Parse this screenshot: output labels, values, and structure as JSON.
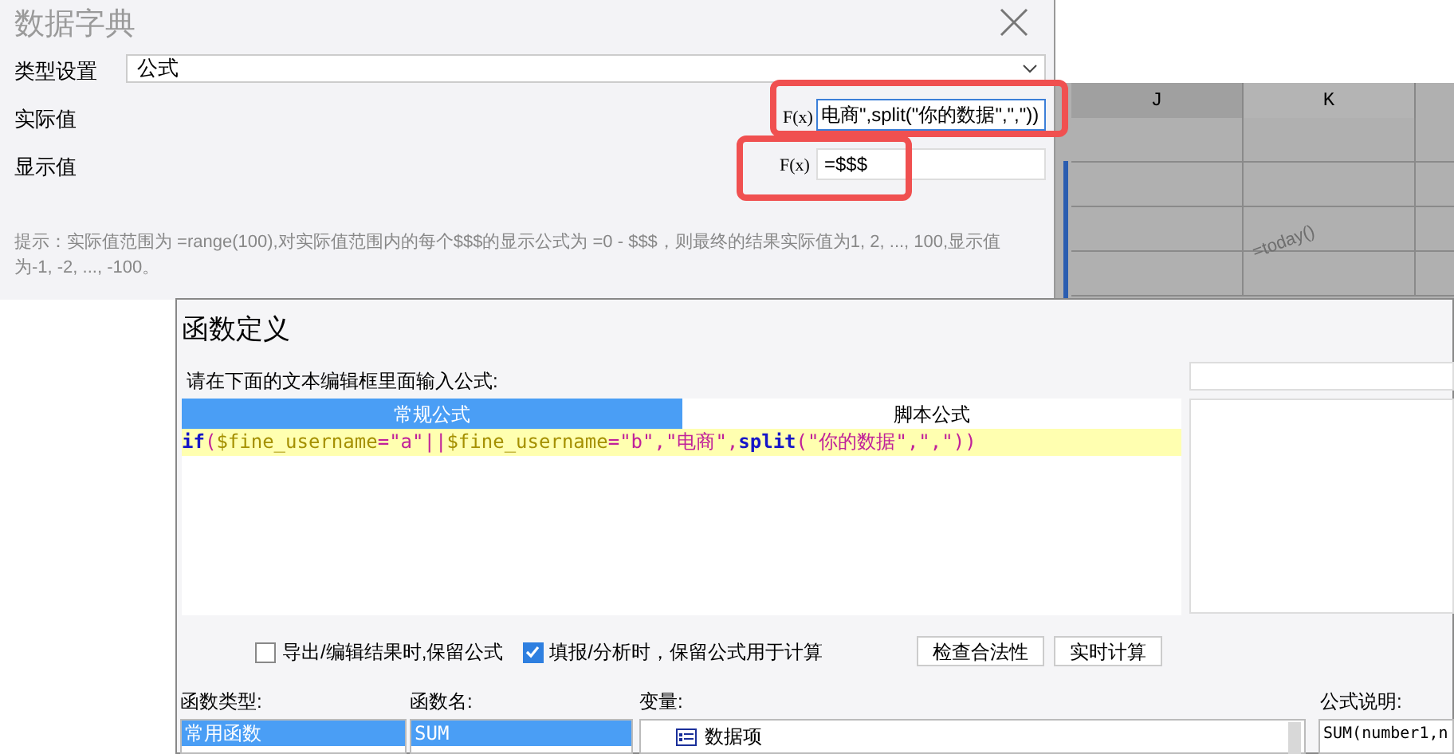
{
  "dictionary_dialog": {
    "title": "数据字典",
    "type_label": "类型设置",
    "type_value": "公式",
    "actual_label": "实际值",
    "actual_value": "电商\",split(\"你的数据\",\",\"))",
    "display_label": "显示值",
    "display_value": "=$$$",
    "actual_fx": "F(x)",
    "display_fx": "F(x)",
    "hint": "提示：实际值范围为 =range(100),对实际值范围内的每个$$$的显示公式为 =0 - $$$，则最终的结果实际值为1, 2, ..., 100,显示值为-1, -2, ..., -100。"
  },
  "spreadsheet": {
    "columns": [
      "J",
      "K"
    ],
    "cell_text": "=today()"
  },
  "function_dialog": {
    "title": "函数定义",
    "prompt": "请在下面的文本编辑框里面输入公式:",
    "tabs": [
      {
        "label": "常规公式",
        "selected": true
      },
      {
        "label": "脚本公式",
        "selected": false
      }
    ],
    "formula": [
      {
        "kind": "function",
        "text": "if"
      },
      {
        "kind": "symbol",
        "text": "("
      },
      {
        "kind": "variable",
        "text": "$fine_username"
      },
      {
        "kind": "symbol",
        "text": "=\"a\"||"
      },
      {
        "kind": "variable",
        "text": "$fine_username"
      },
      {
        "kind": "symbol",
        "text": "=\"b\",\"电商\","
      },
      {
        "kind": "function",
        "text": "split"
      },
      {
        "kind": "symbol",
        "text": "(\"你的数据\",\",\"))"
      }
    ],
    "options": [
      {
        "label": "导出/编辑结果时,保留公式",
        "checked": false
      },
      {
        "label": "填报/分析时，保留公式用于计算",
        "checked": true
      }
    ],
    "buttons": [
      "检查合法性",
      "实时计算"
    ],
    "function_types": {
      "label": "函数类型:",
      "items": [
        {
          "label": "常用函数",
          "selected": true
        }
      ]
    },
    "function_names": {
      "label": "函数名:",
      "items": [
        {
          "label": "SUM",
          "selected": true
        }
      ]
    },
    "variables": {
      "label": "变量:",
      "items": [
        {
          "label": "数据项"
        }
      ]
    },
    "description": {
      "label": "公式说明:",
      "text": "SUM(number1,n"
    }
  }
}
